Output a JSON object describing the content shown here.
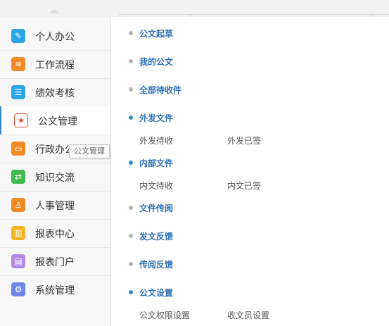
{
  "colors": {
    "accent": "#2e88d3",
    "section_title": "#2e6fb7",
    "dot_collapsed": "#b5b5b5",
    "dot_expanded": "#2e88d3"
  },
  "sidebar": {
    "items": [
      {
        "label": "个人办公",
        "icon": "edit-icon",
        "icon_bg": "#2aa6e6",
        "glyph": "✎"
      },
      {
        "label": "工作流程",
        "icon": "workflow-icon",
        "icon_bg": "#f08a24",
        "glyph": "≡"
      },
      {
        "label": "绩效考核",
        "icon": "list-icon",
        "icon_bg": "#2aa6e6",
        "glyph": "☰"
      },
      {
        "label": "公文管理",
        "icon": "star-icon",
        "icon_bg": "#e8533a",
        "glyph": "★",
        "active": true
      },
      {
        "label": "行政办公",
        "icon": "folder-icon",
        "icon_bg": "#f08a24",
        "glyph": "▭"
      },
      {
        "label": "知识交流",
        "icon": "knowledge-icon",
        "icon_bg": "#3dbb4e",
        "glyph": "⇄"
      },
      {
        "label": "人事管理",
        "icon": "hr-icon",
        "icon_bg": "#f08a24",
        "glyph": "♙"
      },
      {
        "label": "报表中心",
        "icon": "report-icon",
        "icon_bg": "#f5b324",
        "glyph": "▥"
      },
      {
        "label": "报表门户",
        "icon": "portal-icon",
        "icon_bg": "#b28be6",
        "glyph": "▤"
      },
      {
        "label": "系统管理",
        "icon": "gear-icon",
        "icon_bg": "#6f86e8",
        "glyph": "⚙"
      }
    ]
  },
  "tooltip": {
    "text": "公文管理"
  },
  "menu": {
    "sections": [
      {
        "title": "公文起草",
        "expanded": false,
        "links": []
      },
      {
        "title": "我的公文",
        "expanded": false,
        "links": []
      },
      {
        "title": "全部待收件",
        "expanded": false,
        "links": []
      },
      {
        "title": "外发文件",
        "expanded": true,
        "links": [
          "外发待收",
          "外发已签"
        ]
      },
      {
        "title": "内部文件",
        "expanded": true,
        "links": [
          "内文待收",
          "内文已签"
        ]
      },
      {
        "title": "文件传阅",
        "expanded": false,
        "links": []
      },
      {
        "title": "发文反馈",
        "expanded": false,
        "links": []
      },
      {
        "title": "传阅反馈",
        "expanded": false,
        "links": []
      },
      {
        "title": "公文设置",
        "expanded": true,
        "links": [
          "公文权限设置",
          "收文员设置"
        ]
      }
    ]
  }
}
